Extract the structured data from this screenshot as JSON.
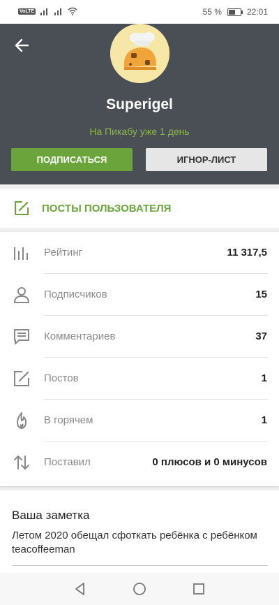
{
  "status_bar": {
    "network_badge": "VoLTE",
    "battery_percent": "55 %",
    "time": "22:01"
  },
  "profile": {
    "username": "Superigel",
    "since": "На Пикабу уже 1 день",
    "subscribe_label": "ПОДПИСАТЬСЯ",
    "ignore_label": "ИГНОР-ЛИСТ"
  },
  "posts": {
    "label": "ПОСТЫ ПОЛЬЗОВАТЕЛЯ"
  },
  "stats": [
    {
      "icon": "bars-icon",
      "label": "Рейтинг",
      "value": "11 317,5"
    },
    {
      "icon": "person-icon",
      "label": "Подписчиков",
      "value": "15"
    },
    {
      "icon": "comment-icon",
      "label": "Комментариев",
      "value": "37"
    },
    {
      "icon": "edit-icon",
      "label": "Постов",
      "value": "1"
    },
    {
      "icon": "flame-icon",
      "label": "В горячем",
      "value": "1"
    },
    {
      "icon": "swap-icon",
      "label": "Поставил",
      "value": "0 плюсов и 0 минусов"
    }
  ],
  "note": {
    "title": "Ваша заметка",
    "text": "Летом 2020 обещал сфоткать ребёнка с ребёнком teacoffeeman"
  },
  "colors": {
    "accent_green": "#6aa43a",
    "header_bg": "#4a4f56",
    "since_green": "#8bb54a"
  }
}
